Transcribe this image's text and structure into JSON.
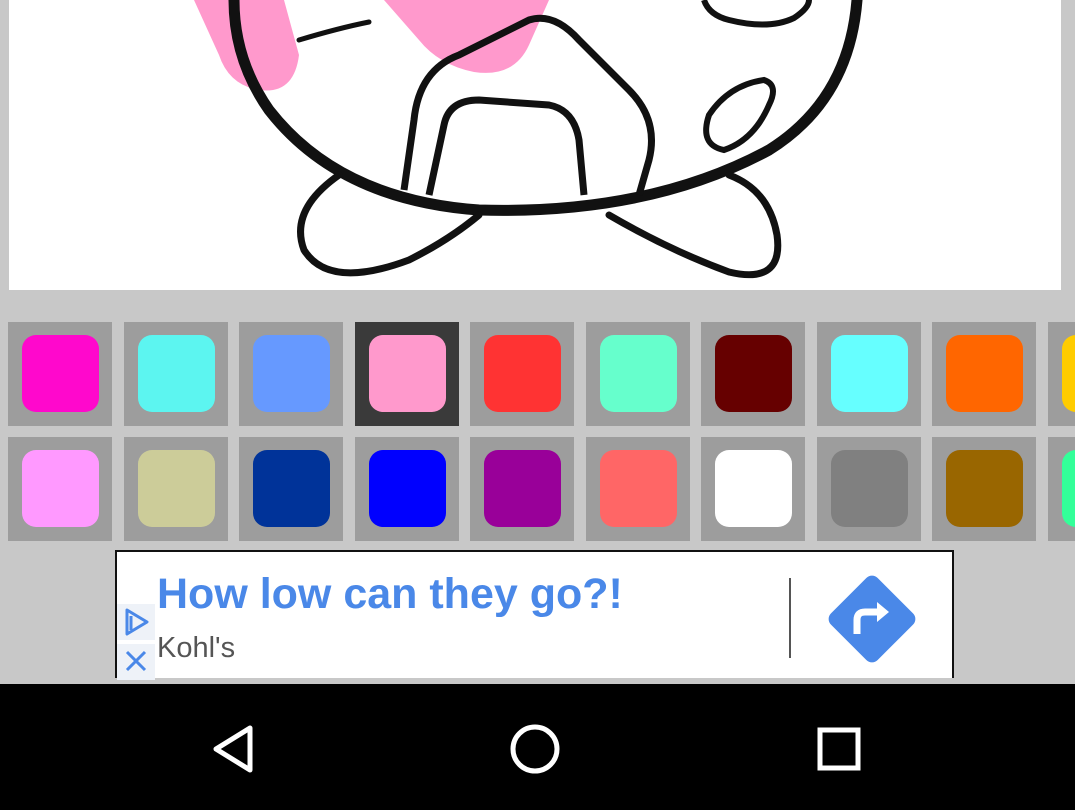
{
  "palette": {
    "selected_index": 3,
    "row1": [
      {
        "color": "#ff08cc",
        "name": "magenta"
      },
      {
        "color": "#5cf5f0",
        "name": "light-cyan"
      },
      {
        "color": "#6699ff",
        "name": "cornflower-blue"
      },
      {
        "color": "#ff99cc",
        "name": "pink"
      },
      {
        "color": "#ff3333",
        "name": "red"
      },
      {
        "color": "#66ffcc",
        "name": "aquamarine"
      },
      {
        "color": "#660000",
        "name": "maroon"
      },
      {
        "color": "#66ffff",
        "name": "cyan"
      },
      {
        "color": "#ff6600",
        "name": "orange"
      },
      {
        "color": "#ffcc00",
        "name": "yellow"
      }
    ],
    "row2": [
      {
        "color": "#ff99ff",
        "name": "light-pink"
      },
      {
        "color": "#cccc99",
        "name": "khaki"
      },
      {
        "color": "#003399",
        "name": "navy-blue"
      },
      {
        "color": "#0000ff",
        "name": "blue"
      },
      {
        "color": "#990099",
        "name": "purple"
      },
      {
        "color": "#ff6666",
        "name": "salmon"
      },
      {
        "color": "#ffffff",
        "name": "white"
      },
      {
        "color": "#808080",
        "name": "gray"
      },
      {
        "color": "#996600",
        "name": "brown"
      },
      {
        "color": "#33ff99",
        "name": "spring-green"
      }
    ]
  },
  "ad": {
    "headline": "How low can they go?!",
    "advertiser": "Kohl's",
    "accent_color": "#4a88e8",
    "icons": {
      "choices": "adchoices-icon",
      "close": "close-icon",
      "go": "share-arrow-icon"
    }
  },
  "navbar": {
    "icons": [
      "back-icon",
      "home-icon",
      "recents-icon"
    ]
  },
  "drawing": {
    "fill_color": "#ff99cc",
    "subject": "coloring-page-outline"
  }
}
